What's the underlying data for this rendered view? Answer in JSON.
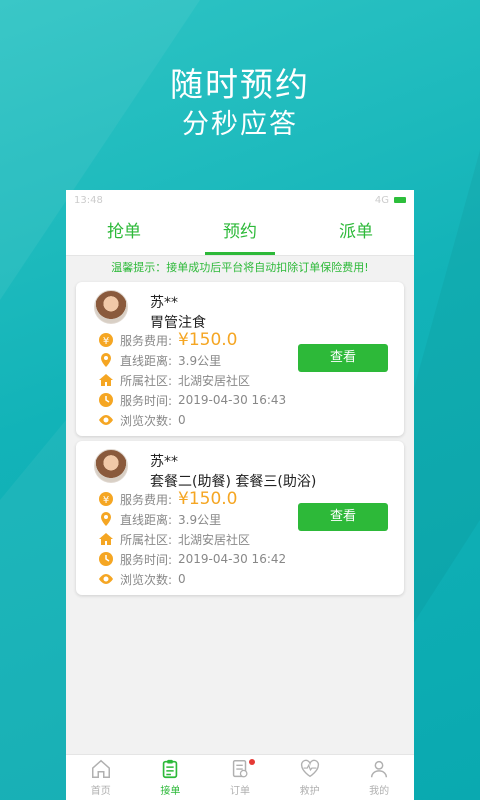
{
  "hero": {
    "title": "随时预约",
    "subtitle": "分秒应答"
  },
  "statusbar": {
    "time": "13:48",
    "network": "4G"
  },
  "tabs": [
    {
      "label": "抢单",
      "active": false
    },
    {
      "label": "预约",
      "active": true
    },
    {
      "label": "派单",
      "active": false
    }
  ],
  "notice": "温馨提示：接单成功后平台将自动扣除订单保险费用!",
  "labels": {
    "fee": "服务费用:",
    "distance": "直线距离:",
    "community": "所属社区:",
    "time": "服务时间:",
    "views": "浏览次数:"
  },
  "orders": [
    {
      "name": "苏**",
      "service": "胃管注食",
      "fee": "¥150.0",
      "distance": "3.9公里",
      "community": "北湖安居社区",
      "time": "2019-04-30 16:43",
      "views": "0",
      "button": "查看"
    },
    {
      "name": "苏**",
      "service": "套餐二(助餐) 套餐三(助浴)",
      "fee": "¥150.0",
      "distance": "3.9公里",
      "community": "北湖安居社区",
      "time": "2019-04-30 16:42",
      "views": "0",
      "button": "查看"
    }
  ],
  "nav": [
    {
      "label": "首页",
      "icon": "home-icon",
      "active": false
    },
    {
      "label": "接单",
      "icon": "clipboard-icon",
      "active": true
    },
    {
      "label": "订单",
      "icon": "order-icon",
      "active": false,
      "badge": true
    },
    {
      "label": "救护",
      "icon": "heart-pulse-icon",
      "active": false
    },
    {
      "label": "我的",
      "icon": "user-icon",
      "active": false
    }
  ],
  "colors": {
    "accent": "#2db939",
    "price": "#f5a623",
    "background": "#12b3b8"
  }
}
